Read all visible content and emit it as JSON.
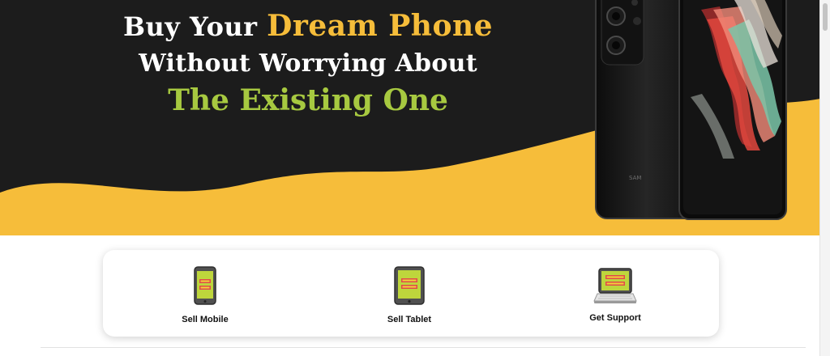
{
  "hero": {
    "headline_line1_prefix": "Buy Your ",
    "headline_line1_accent": "Dream Phone",
    "headline_line2": "Without Worrying About",
    "headline_line3": "The Existing One",
    "phone_brand_text": "SAM",
    "colors": {
      "background": "#1c1c1c",
      "wave": "#f6bd3a",
      "accent_yellow": "#f6bd3a",
      "accent_green": "#a7c940"
    }
  },
  "services": {
    "items": [
      {
        "label": "Sell Mobile",
        "icon": "mobile-icon"
      },
      {
        "label": "Sell Tablet",
        "icon": "tablet-icon"
      },
      {
        "label": "Get Support",
        "icon": "laptop-icon"
      }
    ]
  }
}
